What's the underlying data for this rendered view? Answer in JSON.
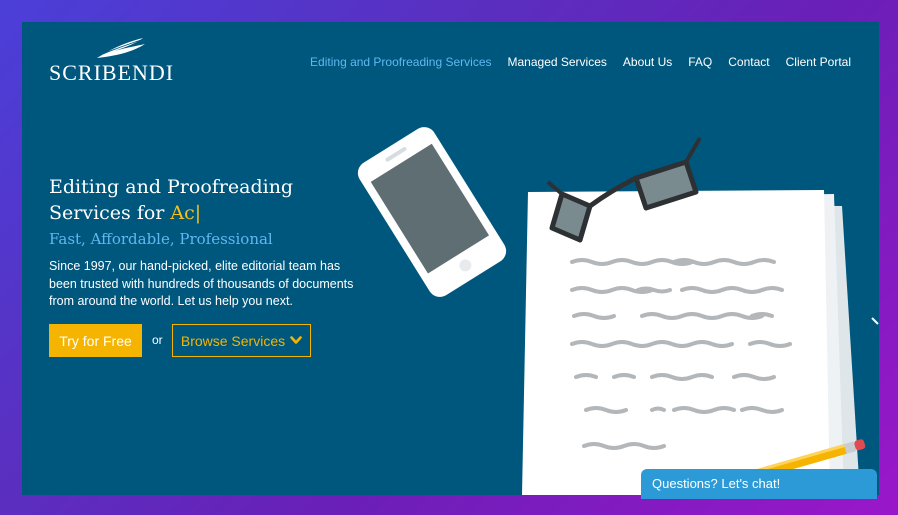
{
  "header": {
    "logo_text": "SCRIBENDI",
    "nav": [
      {
        "label": "Editing and Proofreading Services",
        "active": true
      },
      {
        "label": "Managed Services"
      },
      {
        "label": "About Us"
      },
      {
        "label": "FAQ"
      },
      {
        "label": "Contact"
      },
      {
        "label": "Client Portal"
      }
    ]
  },
  "hero": {
    "headline_static": "Editing and Proofreading Services for ",
    "headline_typed": "Ac|",
    "subhead": "Fast, Affordable, Professional",
    "description": "Since 1997, our hand-picked, elite editorial team has been trusted with hundreds of thousands of documents from around the world. Let us help you next.",
    "primary_button": "Try for Free",
    "or_text": "or",
    "secondary_button": "Browse Services"
  },
  "chat": {
    "label": "Questions? Let's chat!"
  },
  "colors": {
    "background": "#00577e",
    "accent_yellow": "#f5b400",
    "link_blue": "#5fb8ef",
    "chat_blue": "#2d9ad8"
  },
  "icons": {
    "logo_mark": "quill-feather-icon",
    "dropdown": "chevron-down-icon"
  }
}
